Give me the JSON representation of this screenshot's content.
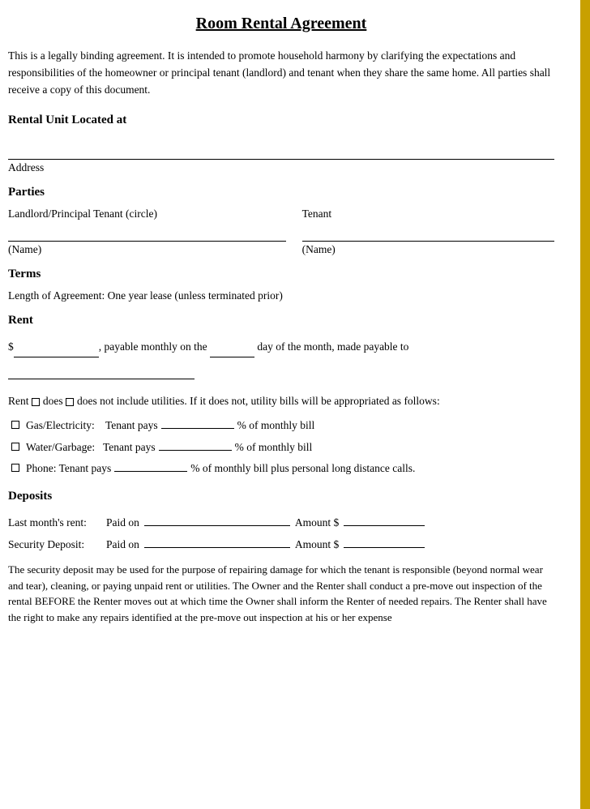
{
  "document": {
    "title": "Room Rental Agreement",
    "intro": "This is a legally binding agreement. It is intended to promote household harmony by clarifying the expectations and responsibilities of the homeowner or principal tenant (landlord) and tenant when they share the same home. All parties shall receive a copy of this document.",
    "sections": {
      "rental_unit": {
        "heading": "Rental Unit Located at",
        "address_label": "Address"
      },
      "parties": {
        "heading": "Parties",
        "landlord_label": "Landlord/Principal Tenant (circle)",
        "tenant_label": "Tenant",
        "name_label": "(Name)",
        "name_label2": "(Name)"
      },
      "terms": {
        "heading": "Terms",
        "text": "Length of Agreement: One year lease (unless terminated prior)"
      },
      "rent": {
        "heading": "Rent",
        "text_prefix": "$",
        "text_mid1": ", payable monthly on the",
        "text_mid2": "day of the month, made payable to",
        "utilities_text": "Rent □does □does not include utilities. If it does not, utility bills will be appropriated as follows:",
        "utilities": [
          {
            "label": "Gas/Electricity:",
            "text": "Tenant pays",
            "suffix": "% of monthly bill"
          },
          {
            "label": "Water/Garbage:",
            "text": "Tenant pays",
            "suffix": "% of monthly bill"
          },
          {
            "label": "Phone: Tenant pays",
            "text": "",
            "suffix": "% of monthly bill plus personal long distance calls."
          }
        ]
      },
      "deposits": {
        "heading": "Deposits",
        "rows": [
          {
            "label": "Last month’s rent:",
            "paid_on": "Paid on",
            "amount_prefix": "Amount $"
          },
          {
            "label": "Security Deposit:",
            "paid_on": "Paid on",
            "amount_prefix": "Amount $"
          }
        ],
        "security_text": "The security deposit may be used for the purpose of repairing damage for which the tenant is responsible (beyond normal wear and tear), cleaning, or paying unpaid rent or utilities. The Owner and the Renter shall conduct a pre-move out inspection of the rental BEFORE the Renter moves out at which time the Owner shall inform the Renter of needed repairs. The Renter shall have the right to make any repairs identified at the pre-move out inspection at his or her expense"
      }
    }
  }
}
